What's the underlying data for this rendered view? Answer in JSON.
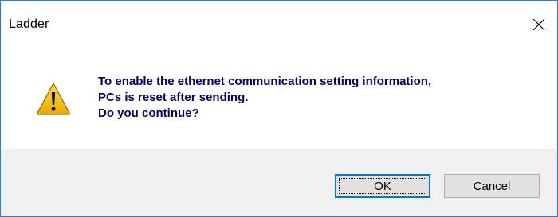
{
  "dialog": {
    "title": "Ladder",
    "close_icon": "close-icon",
    "warning_icon": "warning-icon",
    "message": {
      "line1": "To enable the ethernet communication setting information,",
      "line2": "PCs is reset after sending.",
      "line3": "Do you continue?"
    },
    "buttons": {
      "ok_label": "OK",
      "cancel_label": "Cancel"
    },
    "colors": {
      "border": "#1883d7",
      "message_text": "#000066",
      "footer_bg": "#f0f0f0",
      "ok_focus_border": "#0078d7",
      "warning_fill": "#f5c400"
    }
  }
}
